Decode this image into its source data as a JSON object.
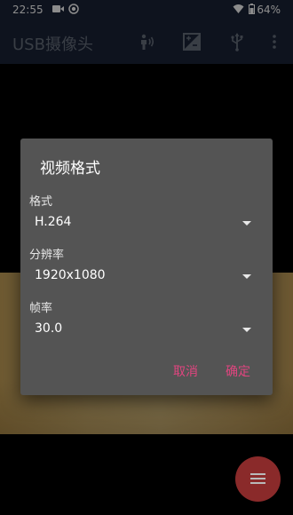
{
  "status_bar": {
    "time": "22:55",
    "battery": "64%",
    "icons": [
      "video-camera-icon",
      "record-icon",
      "wifi-icon",
      "battery-icon"
    ]
  },
  "app_bar": {
    "title": "USB摄像头",
    "actions": [
      "audio-wave-icon",
      "brightness-contrast-icon",
      "usb-icon",
      "more-vert-icon"
    ]
  },
  "dialog": {
    "title": "视频格式",
    "fields": [
      {
        "label": "格式",
        "value": "H.264"
      },
      {
        "label": "分辨率",
        "value": "1920x1080"
      },
      {
        "label": "帧率",
        "value": "30.0"
      }
    ],
    "cancel_label": "取消",
    "confirm_label": "确定"
  },
  "colors": {
    "app_bar": "#1b2338",
    "dialog_bg": "#545454",
    "accent": "#e0457f",
    "fab": "#8a2a2a"
  },
  "fab": {
    "icon": "menu-lines-icon"
  }
}
